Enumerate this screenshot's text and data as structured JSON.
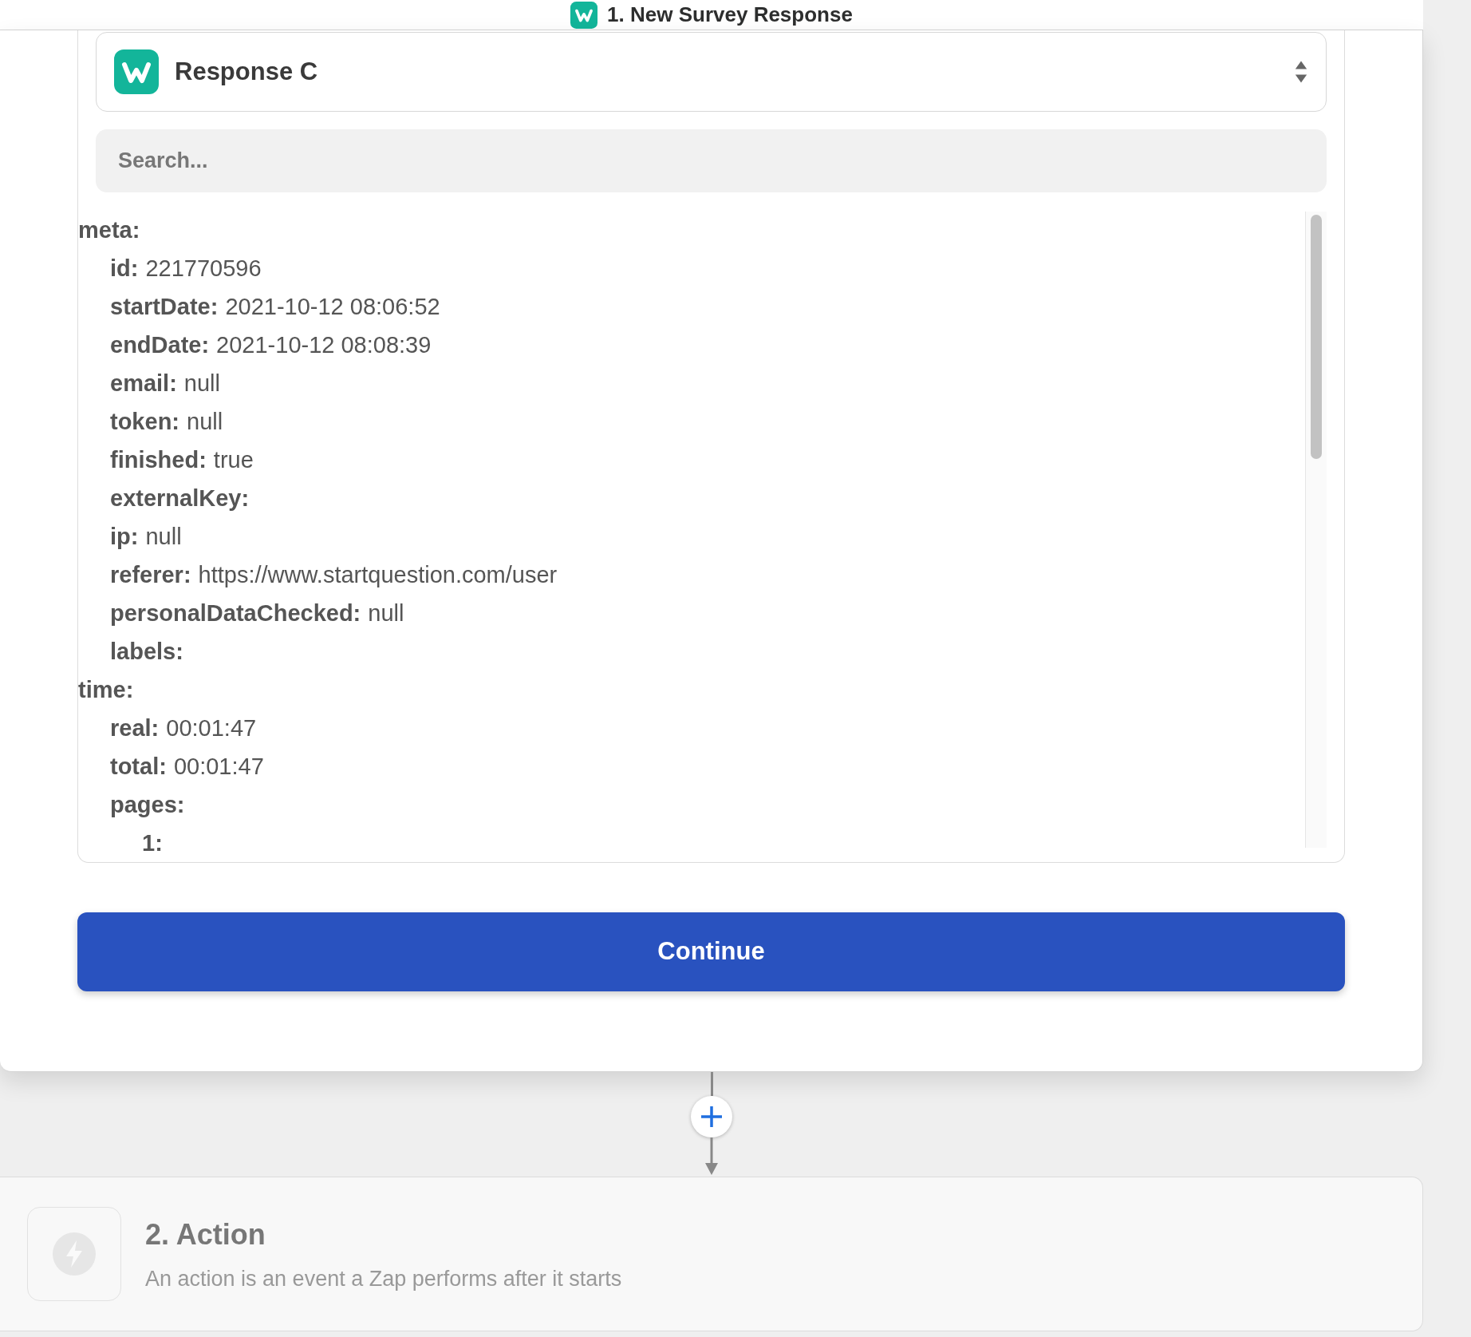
{
  "step_header": {
    "title": "1. New Survey Response"
  },
  "record_select": {
    "label": "Response C"
  },
  "search": {
    "placeholder": "Search..."
  },
  "fields": [
    {
      "key": "meta:",
      "children": [
        {
          "key": "id:",
          "value": "221770596"
        },
        {
          "key": "startDate:",
          "value": "2021-10-12 08:06:52"
        },
        {
          "key": "endDate:",
          "value": "2021-10-12 08:08:39"
        },
        {
          "key": "email:",
          "value": "null"
        },
        {
          "key": "token:",
          "value": "null"
        },
        {
          "key": "finished:",
          "value": "true"
        },
        {
          "key": "externalKey:"
        },
        {
          "key": "ip:",
          "value": "null"
        },
        {
          "key": "referer:",
          "value": "https://www.startquestion.com/user"
        },
        {
          "key": "personalDataChecked:",
          "value": "null"
        },
        {
          "key": "labels:"
        }
      ]
    },
    {
      "key": "time:",
      "children": [
        {
          "key": "real:",
          "value": "00:01:47"
        },
        {
          "key": "total:",
          "value": "00:01:47"
        },
        {
          "key": "pages:",
          "children": [
            {
              "key": "1:"
            }
          ]
        }
      ]
    }
  ],
  "continue_button": {
    "label": "Continue"
  },
  "next_step": {
    "title": "2. Action",
    "description": "An action is an event a Zap performs after it starts"
  }
}
